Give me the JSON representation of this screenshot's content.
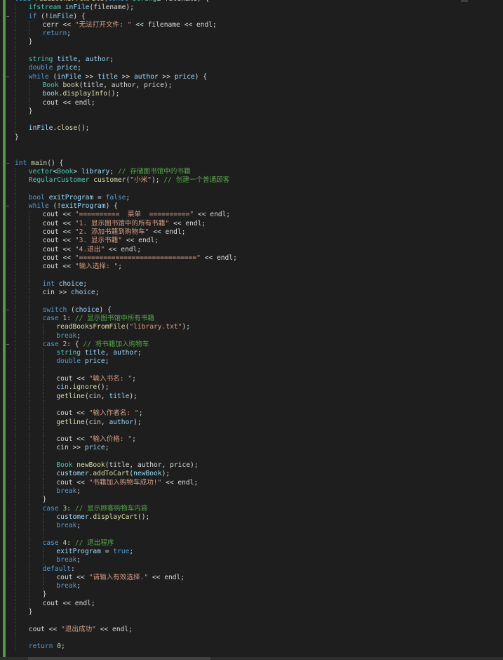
{
  "theme": {
    "keyword": "#569cd6",
    "type": "#4ec9b0",
    "string": "#d69d85",
    "comment": "#57a64a",
    "plain": "#dcdcdc",
    "function": "#dcdcaa",
    "variable": "#9cdcfe",
    "number": "#b5cea8",
    "kw2": "#569cd6",
    "member": "#dcdcdc"
  },
  "lines": [
    {
      "indent": 0,
      "fold": "",
      "tokens": [
        [
          "keyword",
          "void "
        ],
        [
          "function",
          "readBooksFromFile"
        ],
        [
          "plain",
          "("
        ],
        [
          "keyword",
          "const "
        ],
        [
          "type",
          "string"
        ],
        [
          "plain",
          "& filename) {"
        ]
      ]
    },
    {
      "indent": 1,
      "tokens": [
        [
          "type",
          "ifstream "
        ],
        [
          "variable",
          "inFile"
        ],
        [
          "plain",
          "(filename);"
        ]
      ]
    },
    {
      "indent": 1,
      "fold": "−",
      "tokens": [
        [
          "keyword",
          "if "
        ],
        [
          "plain",
          "(!"
        ],
        [
          "variable",
          "inFile"
        ],
        [
          "plain",
          ") {"
        ]
      ]
    },
    {
      "indent": 2,
      "tokens": [
        [
          "plain",
          "cerr << "
        ],
        [
          "string",
          "\"无法打开文件: \""
        ],
        [
          "plain",
          " << filename << endl;"
        ]
      ]
    },
    {
      "indent": 2,
      "tokens": [
        [
          "keyword",
          "return"
        ],
        [
          "plain",
          ";"
        ]
      ]
    },
    {
      "indent": 1,
      "tokens": [
        [
          "plain",
          "}"
        ]
      ]
    },
    {
      "indent": 1,
      "tokens": []
    },
    {
      "indent": 1,
      "tokens": [
        [
          "type",
          "string "
        ],
        [
          "variable",
          "title"
        ],
        [
          "plain",
          ", "
        ],
        [
          "variable",
          "author"
        ],
        [
          "plain",
          ";"
        ]
      ]
    },
    {
      "indent": 1,
      "tokens": [
        [
          "keyword",
          "double "
        ],
        [
          "variable",
          "price"
        ],
        [
          "plain",
          ";"
        ]
      ]
    },
    {
      "indent": 1,
      "fold": "−",
      "tokens": [
        [
          "keyword",
          "while "
        ],
        [
          "plain",
          "("
        ],
        [
          "variable",
          "inFile"
        ],
        [
          "plain",
          " >> "
        ],
        [
          "variable",
          "title"
        ],
        [
          "plain",
          " >> "
        ],
        [
          "variable",
          "author"
        ],
        [
          "plain",
          " >> "
        ],
        [
          "variable",
          "price"
        ],
        [
          "plain",
          ") {"
        ]
      ]
    },
    {
      "indent": 2,
      "tokens": [
        [
          "type",
          "Book "
        ],
        [
          "function",
          "book"
        ],
        [
          "plain",
          "(title, author, price);"
        ]
      ]
    },
    {
      "indent": 2,
      "tokens": [
        [
          "variable",
          "book"
        ],
        [
          "plain",
          "."
        ],
        [
          "function",
          "displayInfo"
        ],
        [
          "plain",
          "();"
        ]
      ]
    },
    {
      "indent": 2,
      "tokens": [
        [
          "plain",
          "cout << endl;"
        ]
      ]
    },
    {
      "indent": 1,
      "tokens": [
        [
          "plain",
          "}"
        ]
      ]
    },
    {
      "indent": 1,
      "tokens": []
    },
    {
      "indent": 1,
      "tokens": [
        [
          "variable",
          "inFile"
        ],
        [
          "plain",
          "."
        ],
        [
          "function",
          "close"
        ],
        [
          "plain",
          "();"
        ]
      ]
    },
    {
      "indent": 0,
      "tokens": [
        [
          "plain",
          "}"
        ]
      ]
    },
    {
      "indent": 0,
      "tokens": []
    },
    {
      "indent": 0,
      "tokens": []
    },
    {
      "indent": 0,
      "fold": "−",
      "tokens": [
        [
          "keyword",
          "int "
        ],
        [
          "function",
          "main"
        ],
        [
          "plain",
          "() {"
        ]
      ]
    },
    {
      "indent": 1,
      "tokens": [
        [
          "type",
          "vector"
        ],
        [
          "plain",
          "<"
        ],
        [
          "type",
          "Book"
        ],
        [
          "plain",
          "> "
        ],
        [
          "variable",
          "library"
        ],
        [
          "plain",
          "; "
        ],
        [
          "comment",
          "// 存储图书馆中的书籍"
        ]
      ]
    },
    {
      "indent": 1,
      "tokens": [
        [
          "type",
          "RegularCustomer "
        ],
        [
          "function",
          "customer"
        ],
        [
          "plain",
          "("
        ],
        [
          "string",
          "\"小米\""
        ],
        [
          "plain",
          "); "
        ],
        [
          "comment",
          "// 创建一个普通顾客"
        ]
      ]
    },
    {
      "indent": 1,
      "tokens": []
    },
    {
      "indent": 1,
      "tokens": [
        [
          "keyword",
          "bool "
        ],
        [
          "variable",
          "exitProgram"
        ],
        [
          "plain",
          " = "
        ],
        [
          "keyword",
          "false"
        ],
        [
          "plain",
          ";"
        ]
      ]
    },
    {
      "indent": 1,
      "fold": "−",
      "tokens": [
        [
          "keyword",
          "while "
        ],
        [
          "plain",
          "(!"
        ],
        [
          "variable",
          "exitProgram"
        ],
        [
          "plain",
          ") {"
        ]
      ]
    },
    {
      "indent": 2,
      "tokens": [
        [
          "plain",
          "cout << "
        ],
        [
          "string",
          "\"==========  菜单  ==========\""
        ],
        [
          "plain",
          " << endl;"
        ]
      ]
    },
    {
      "indent": 2,
      "tokens": [
        [
          "plain",
          "cout << "
        ],
        [
          "string",
          "\"1. 显示图书馆中的所有书籍\""
        ],
        [
          "plain",
          " << endl;"
        ]
      ]
    },
    {
      "indent": 2,
      "tokens": [
        [
          "plain",
          "cout << "
        ],
        [
          "string",
          "\"2. 添加书籍到购物车\""
        ],
        [
          "plain",
          " << endl;"
        ]
      ]
    },
    {
      "indent": 2,
      "tokens": [
        [
          "plain",
          "cout << "
        ],
        [
          "string",
          "\"3. 显示书籍\""
        ],
        [
          "plain",
          " << endl;"
        ]
      ]
    },
    {
      "indent": 2,
      "tokens": [
        [
          "plain",
          "cout << "
        ],
        [
          "string",
          "\"4.退出\""
        ],
        [
          "plain",
          " << endl;"
        ]
      ]
    },
    {
      "indent": 2,
      "tokens": [
        [
          "plain",
          "cout << "
        ],
        [
          "string",
          "\"=============================\""
        ],
        [
          "plain",
          " << endl;"
        ]
      ]
    },
    {
      "indent": 2,
      "tokens": [
        [
          "plain",
          "cout << "
        ],
        [
          "string",
          "\"输入选择: \""
        ],
        [
          "plain",
          ";"
        ]
      ]
    },
    {
      "indent": 2,
      "tokens": []
    },
    {
      "indent": 2,
      "tokens": [
        [
          "keyword",
          "int "
        ],
        [
          "variable",
          "choice"
        ],
        [
          "plain",
          ";"
        ]
      ]
    },
    {
      "indent": 2,
      "tokens": [
        [
          "plain",
          "cin >> "
        ],
        [
          "variable",
          "choice"
        ],
        [
          "plain",
          ";"
        ]
      ]
    },
    {
      "indent": 2,
      "tokens": []
    },
    {
      "indent": 2,
      "fold": "−",
      "tokens": [
        [
          "keyword",
          "switch "
        ],
        [
          "plain",
          "("
        ],
        [
          "variable",
          "choice"
        ],
        [
          "plain",
          ") {"
        ]
      ]
    },
    {
      "indent": 2,
      "tokens": [
        [
          "keyword",
          "case "
        ],
        [
          "number",
          "1"
        ],
        [
          "plain",
          ": "
        ],
        [
          "comment",
          "// 显示图书馆中所有书籍"
        ]
      ]
    },
    {
      "indent": 3,
      "tokens": [
        [
          "function",
          "readBooksFromFile"
        ],
        [
          "plain",
          "("
        ],
        [
          "string",
          "\"library.txt\""
        ],
        [
          "plain",
          ");"
        ]
      ]
    },
    {
      "indent": 3,
      "tokens": [
        [
          "keyword",
          "break"
        ],
        [
          "plain",
          ";"
        ]
      ]
    },
    {
      "indent": 2,
      "fold": "−",
      "tokens": [
        [
          "keyword",
          "case "
        ],
        [
          "number",
          "2"
        ],
        [
          "plain",
          ": { "
        ],
        [
          "comment",
          "// 将书籍加入购物车"
        ]
      ]
    },
    {
      "indent": 3,
      "tokens": [
        [
          "type",
          "string "
        ],
        [
          "variable",
          "title"
        ],
        [
          "plain",
          ", "
        ],
        [
          "variable",
          "author"
        ],
        [
          "plain",
          ";"
        ]
      ]
    },
    {
      "indent": 3,
      "tokens": [
        [
          "keyword",
          "double "
        ],
        [
          "variable",
          "price"
        ],
        [
          "plain",
          ";"
        ]
      ]
    },
    {
      "indent": 3,
      "tokens": []
    },
    {
      "indent": 3,
      "tokens": [
        [
          "plain",
          "cout << "
        ],
        [
          "string",
          "\"输入书名: \""
        ],
        [
          "plain",
          ";"
        ]
      ]
    },
    {
      "indent": 3,
      "tokens": [
        [
          "variable",
          "cin"
        ],
        [
          "plain",
          "."
        ],
        [
          "function",
          "ignore"
        ],
        [
          "plain",
          "();"
        ]
      ]
    },
    {
      "indent": 3,
      "tokens": [
        [
          "function",
          "getline"
        ],
        [
          "plain",
          "(cin, "
        ],
        [
          "variable",
          "title"
        ],
        [
          "plain",
          ");"
        ]
      ]
    },
    {
      "indent": 3,
      "tokens": []
    },
    {
      "indent": 3,
      "tokens": [
        [
          "plain",
          "cout << "
        ],
        [
          "string",
          "\"输入作者名: \""
        ],
        [
          "plain",
          ";"
        ]
      ]
    },
    {
      "indent": 3,
      "tokens": [
        [
          "function",
          "getline"
        ],
        [
          "plain",
          "(cin, "
        ],
        [
          "variable",
          "author"
        ],
        [
          "plain",
          ");"
        ]
      ]
    },
    {
      "indent": 3,
      "tokens": []
    },
    {
      "indent": 3,
      "tokens": [
        [
          "plain",
          "cout << "
        ],
        [
          "string",
          "\"输入价格: \""
        ],
        [
          "plain",
          ";"
        ]
      ]
    },
    {
      "indent": 3,
      "tokens": [
        [
          "plain",
          "cin >> "
        ],
        [
          "variable",
          "price"
        ],
        [
          "plain",
          ";"
        ]
      ]
    },
    {
      "indent": 3,
      "tokens": []
    },
    {
      "indent": 3,
      "tokens": [
        [
          "type",
          "Book "
        ],
        [
          "function",
          "newBook"
        ],
        [
          "plain",
          "(title, author, price);"
        ]
      ]
    },
    {
      "indent": 3,
      "tokens": [
        [
          "variable",
          "customer"
        ],
        [
          "plain",
          "."
        ],
        [
          "function",
          "addToCart"
        ],
        [
          "plain",
          "("
        ],
        [
          "variable",
          "newBook"
        ],
        [
          "plain",
          ");"
        ]
      ]
    },
    {
      "indent": 3,
      "tokens": [
        [
          "plain",
          "cout << "
        ],
        [
          "string",
          "\"书籍加入购物车成功!\""
        ],
        [
          "plain",
          " << endl;"
        ]
      ]
    },
    {
      "indent": 3,
      "tokens": [
        [
          "keyword",
          "break"
        ],
        [
          "plain",
          ";"
        ]
      ]
    },
    {
      "indent": 2,
      "tokens": [
        [
          "plain",
          "}"
        ]
      ]
    },
    {
      "indent": 2,
      "tokens": [
        [
          "keyword",
          "case "
        ],
        [
          "number",
          "3"
        ],
        [
          "plain",
          ": "
        ],
        [
          "comment",
          "// 显示顾客购物车内容"
        ]
      ]
    },
    {
      "indent": 3,
      "tokens": [
        [
          "variable",
          "customer"
        ],
        [
          "plain",
          "."
        ],
        [
          "function",
          "displayCart"
        ],
        [
          "plain",
          "();"
        ]
      ]
    },
    {
      "indent": 3,
      "tokens": [
        [
          "keyword",
          "break"
        ],
        [
          "plain",
          ";"
        ]
      ]
    },
    {
      "indent": 3,
      "tokens": []
    },
    {
      "indent": 2,
      "tokens": [
        [
          "keyword",
          "case "
        ],
        [
          "number",
          "4"
        ],
        [
          "plain",
          ": "
        ],
        [
          "comment",
          "// 退出程序"
        ]
      ]
    },
    {
      "indent": 3,
      "tokens": [
        [
          "variable",
          "exitProgram"
        ],
        [
          "plain",
          " = "
        ],
        [
          "keyword",
          "true"
        ],
        [
          "plain",
          ";"
        ]
      ]
    },
    {
      "indent": 3,
      "tokens": [
        [
          "keyword",
          "break"
        ],
        [
          "plain",
          ";"
        ]
      ]
    },
    {
      "indent": 2,
      "tokens": [
        [
          "keyword",
          "default"
        ],
        [
          "plain",
          ":"
        ]
      ]
    },
    {
      "indent": 3,
      "tokens": [
        [
          "plain",
          "cout << "
        ],
        [
          "string",
          "\"请输入有效选择.\""
        ],
        [
          "plain",
          " << endl;"
        ]
      ]
    },
    {
      "indent": 3,
      "tokens": [
        [
          "keyword",
          "break"
        ],
        [
          "plain",
          ";"
        ]
      ]
    },
    {
      "indent": 2,
      "tokens": [
        [
          "plain",
          "}"
        ]
      ]
    },
    {
      "indent": 2,
      "tokens": [
        [
          "plain",
          "cout << endl;"
        ]
      ]
    },
    {
      "indent": 1,
      "tokens": [
        [
          "plain",
          "}"
        ]
      ]
    },
    {
      "indent": 1,
      "tokens": []
    },
    {
      "indent": 1,
      "tokens": [
        [
          "plain",
          "cout << "
        ],
        [
          "string",
          "\"退出成功\""
        ],
        [
          "plain",
          " << endl;"
        ]
      ]
    },
    {
      "indent": 1,
      "tokens": []
    },
    {
      "indent": 1,
      "tokens": [
        [
          "keyword",
          "return "
        ],
        [
          "number",
          "0"
        ],
        [
          "plain",
          ";"
        ]
      ]
    }
  ]
}
